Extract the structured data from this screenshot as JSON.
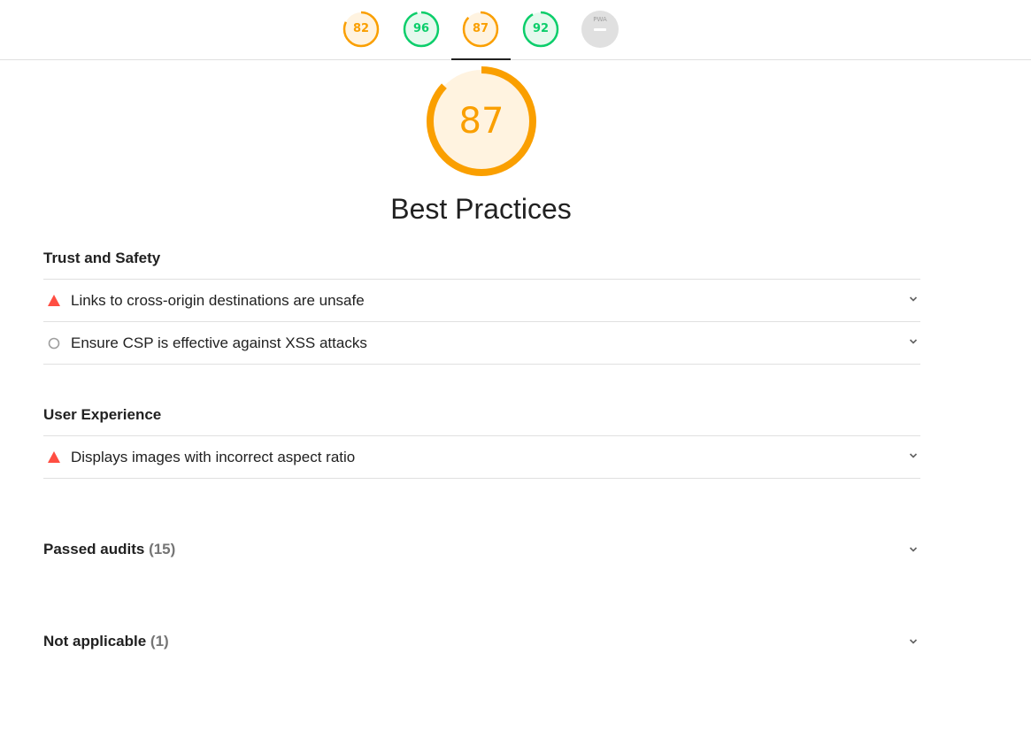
{
  "gauges": [
    {
      "name": "performance",
      "value": "82",
      "score": 0.82,
      "color": "#fa9f00",
      "fill": "#fff3e0"
    },
    {
      "name": "accessibility",
      "value": "96",
      "score": 0.96,
      "color": "#0cce6b",
      "fill": "#e6f9ee"
    },
    {
      "name": "best-practices",
      "value": "87",
      "score": 0.87,
      "color": "#fa9f00",
      "fill": "#fff3e0"
    },
    {
      "name": "seo",
      "value": "92",
      "score": 0.92,
      "color": "#0cce6b",
      "fill": "#e6f9ee"
    },
    {
      "name": "pwa",
      "label": "PWA",
      "color": "#e0e0e0"
    }
  ],
  "category": {
    "score": "87",
    "score_fraction": 0.87,
    "title": "Best Practices",
    "color": "#fa9f00",
    "fill": "#fff3e0"
  },
  "groups": [
    {
      "title": "Trust and Safety",
      "audits": [
        {
          "label": "Links to cross-origin destinations are unsafe",
          "status": "fail",
          "icon": "triangle-warning-icon"
        },
        {
          "label": "Ensure CSP is effective against XSS attacks",
          "status": "informative",
          "icon": "circle-outline-icon"
        }
      ]
    },
    {
      "title": "User Experience",
      "audits": [
        {
          "label": "Displays images with incorrect aspect ratio",
          "status": "fail",
          "icon": "triangle-warning-icon"
        }
      ]
    }
  ],
  "passed": {
    "label": "Passed audits",
    "count": "(15)"
  },
  "not_applicable": {
    "label": "Not applicable",
    "count": "(1)"
  },
  "colors": {
    "fail": "#ff4e42",
    "informative": "#9e9e9e",
    "pass": "#0cce6b",
    "average": "#fa9f00"
  }
}
